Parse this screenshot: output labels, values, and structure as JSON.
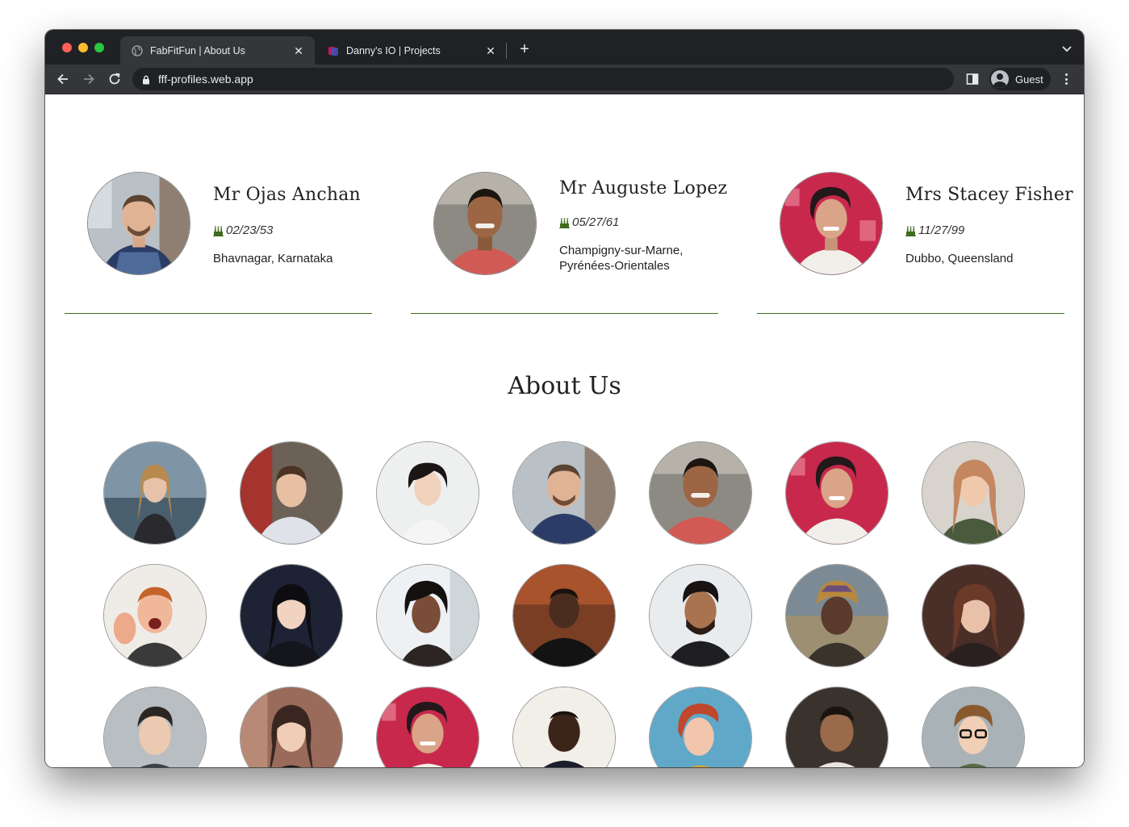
{
  "browser": {
    "tabs": [
      {
        "title": "FabFitFun | About Us",
        "active": true,
        "favicon": "globe-icon"
      },
      {
        "title": "Danny's IO | Projects",
        "active": false,
        "favicon": "app-icon"
      }
    ],
    "url": "fff-profiles.web.app",
    "profile_label": "Guest"
  },
  "featured_profiles": [
    {
      "name": "Mr Ojas Anchan",
      "dob": "02/23/53",
      "location": "Bhavnagar, Karnataka"
    },
    {
      "name": "Mr Auguste Lopez",
      "dob": "05/27/61",
      "location": "Champigny-sur-Marne, Pyrénées-Orientales"
    },
    {
      "name": "Mrs Stacey Fisher",
      "dob": "11/27/99",
      "location": "Dubbo, Queensland"
    }
  ],
  "about": {
    "heading": "About Us"
  },
  "colors": {
    "divider": "#3e6b1e",
    "text": "#222222"
  }
}
